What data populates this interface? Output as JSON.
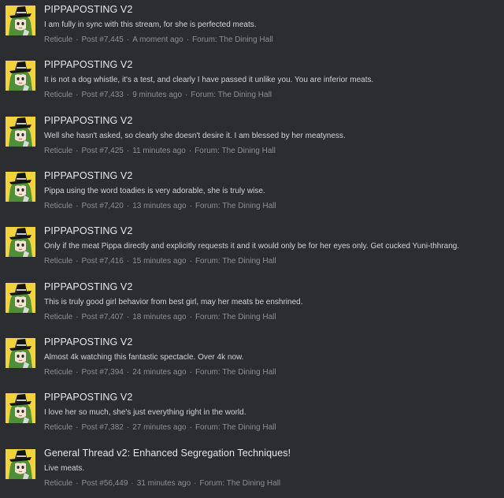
{
  "colors": {
    "background": "#2b2d31",
    "title": "#e8e8e8",
    "snippet": "#d4d4d4",
    "meta": "#8f8f8f",
    "avatar_bg": "#f2d33c",
    "avatar_hair": "#4f8f3a",
    "avatar_hat": "#141414"
  },
  "separator": "·",
  "items": [
    {
      "title": "PIPPAPOSTING V2",
      "snippet": "I am fully in sync with this stream, for she is perfected meats.",
      "author": "Reticule",
      "post": "Post #7,445",
      "time": "A moment ago",
      "forum": "Forum: The Dining Hall"
    },
    {
      "title": "PIPPAPOSTING V2",
      "snippet": "It is not a dog whistle, it's a test, and clearly I have passed it unlike you. You are inferior meats.",
      "author": "Reticule",
      "post": "Post #7,433",
      "time": "9 minutes ago",
      "forum": "Forum: The Dining Hall"
    },
    {
      "title": "PIPPAPOSTING V2",
      "snippet": "Well she hasn't asked, so clearly she doesn't desire it. I am blessed by her meatyness.",
      "author": "Reticule",
      "post": "Post #7,425",
      "time": "11 minutes ago",
      "forum": "Forum: The Dining Hall"
    },
    {
      "title": "PIPPAPOSTING V2",
      "snippet": "Pippa using the word toadies is very adorable, she is truly wise.",
      "author": "Reticule",
      "post": "Post #7,420",
      "time": "13 minutes ago",
      "forum": "Forum: The Dining Hall"
    },
    {
      "title": "PIPPAPOSTING V2",
      "snippet": "Only if the meat Pippa directly and explicitly requests it and it would only be for her eyes only. Get cucked Yuni-thhrang.",
      "author": "Reticule",
      "post": "Post #7,416",
      "time": "15 minutes ago",
      "forum": "Forum: The Dining Hall"
    },
    {
      "title": "PIPPAPOSTING V2",
      "snippet": "This is truly good girl behavior from best girl, may her meats be enshrined.",
      "author": "Reticule",
      "post": "Post #7,407",
      "time": "18 minutes ago",
      "forum": "Forum: The Dining Hall"
    },
    {
      "title": "PIPPAPOSTING V2",
      "snippet": "Almost 4k watching this fantastic spectacle. Over 4k now.",
      "author": "Reticule",
      "post": "Post #7,394",
      "time": "24 minutes ago",
      "forum": "Forum: The Dining Hall"
    },
    {
      "title": "PIPPAPOSTING V2",
      "snippet": "I love her so much, she's just everything right in the world.",
      "author": "Reticule",
      "post": "Post #7,382",
      "time": "27 minutes ago",
      "forum": "Forum: The Dining Hall"
    },
    {
      "title": "General Thread v2: Enhanced Segregation Techniques!",
      "snippet": "Live meats.",
      "author": "Reticule",
      "post": "Post #56,449",
      "time": "31 minutes ago",
      "forum": "Forum: The Dining Hall"
    }
  ]
}
